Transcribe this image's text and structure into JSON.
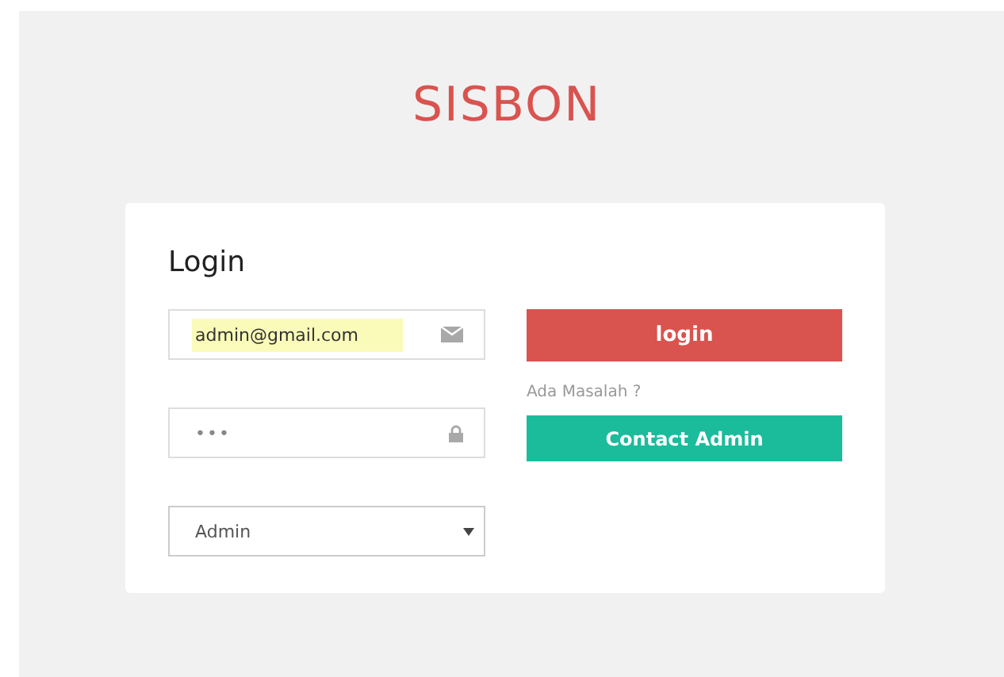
{
  "brand": "SISBON",
  "login": {
    "title": "Login",
    "email": {
      "value": "admin@gmail.com",
      "autofilled": true
    },
    "password": {
      "value": "•••"
    },
    "role": {
      "value": "Admin"
    },
    "submit": "login",
    "help_text": "Ada Masalah ?",
    "contact": "Contact Admin"
  }
}
